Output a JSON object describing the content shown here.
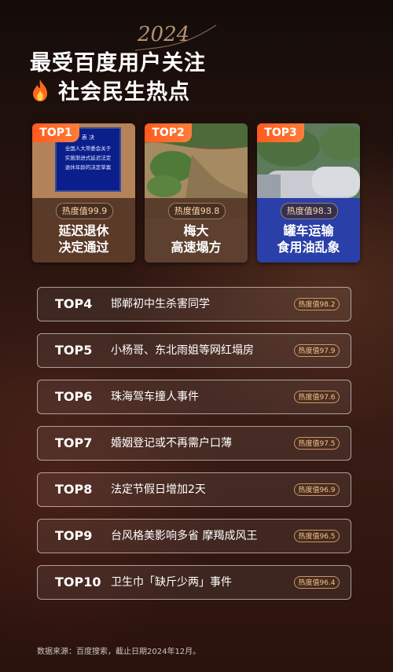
{
  "header": {
    "year_script": "2024",
    "title_line1": "最受百度用户关注",
    "title_line2": "社会民生热点"
  },
  "top_cards": [
    {
      "badge": "TOP1",
      "heat": "热度值99.9",
      "caption_line1": "延迟退休",
      "caption_line2": "决定通过",
      "photo_text": [
        "表 决",
        "全国人大常委会关于",
        "实施渐进式延迟法定",
        "退休年龄的决定草案"
      ]
    },
    {
      "badge": "TOP2",
      "heat": "热度值98.8",
      "caption_line1": "梅大",
      "caption_line2": "高速塌方"
    },
    {
      "badge": "TOP3",
      "heat": "热度值98.3",
      "caption_line1": "罐车运输",
      "caption_line2": "食用油乱象"
    }
  ],
  "rows": [
    {
      "rank": "TOP4",
      "title": "邯郸初中生杀害同学",
      "heat": "热度值98.2"
    },
    {
      "rank": "TOP5",
      "title": "小杨哥、东北雨姐等网红塌房",
      "heat": "热度值97.9"
    },
    {
      "rank": "TOP6",
      "title": "珠海驾车撞人事件",
      "heat": "热度值97.6"
    },
    {
      "rank": "TOP7",
      "title": "婚姻登记或不再需户口薄",
      "heat": "热度值97.5"
    },
    {
      "rank": "TOP8",
      "title": "法定节假日增加2天",
      "heat": "热度值96.9"
    },
    {
      "rank": "TOP9",
      "title": "台风格美影响多省 摩羯成风王",
      "heat": "热度值96.5"
    },
    {
      "rank": "TOP10",
      "title": "卫生巾「缺斤少两」事件",
      "heat": "热度值96.4"
    }
  ],
  "footer": {
    "source": "数据来源：百度搜索，截止日期2024年12月。"
  },
  "colors": {
    "accent_orange": "#ff5a1f",
    "heat_text": "#f0c595",
    "card3_caption_bg": "#2a3fa8"
  }
}
